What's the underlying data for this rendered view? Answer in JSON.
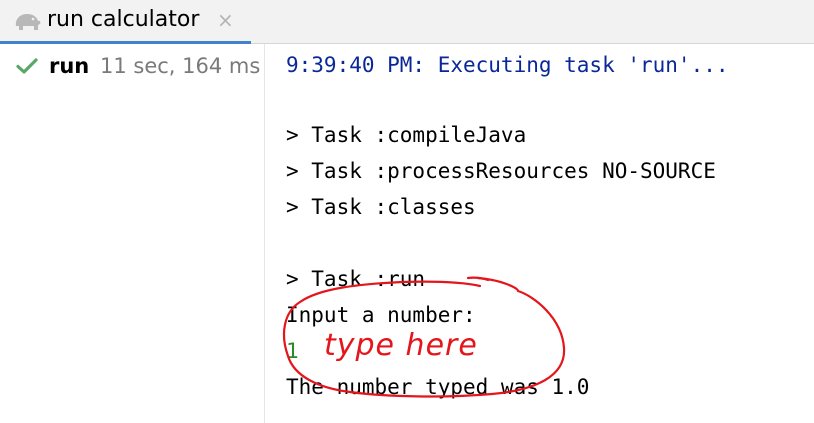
{
  "tab": {
    "title": "run calculator",
    "icon": "gradle-elephant-icon",
    "close_glyph": "×",
    "underline_color": "#4083c9"
  },
  "build_tree": {
    "items": [
      {
        "status_icon": "check-icon",
        "status_color": "#59a869",
        "task": "run",
        "duration": "11 sec, 164 ms"
      }
    ]
  },
  "console": {
    "header_color": "#0a2797",
    "input_color": "#2d8a28",
    "lines": [
      "9:39:40 PM: Executing task 'run'...",
      "",
      "> Task :compileJava",
      "> Task :processResources NO-SOURCE",
      "> Task :classes",
      "",
      "> Task :run",
      "Input a number:",
      "1",
      "The number typed was 1.0"
    ]
  },
  "annotation": {
    "text": "type here",
    "color": "#e4151b"
  }
}
